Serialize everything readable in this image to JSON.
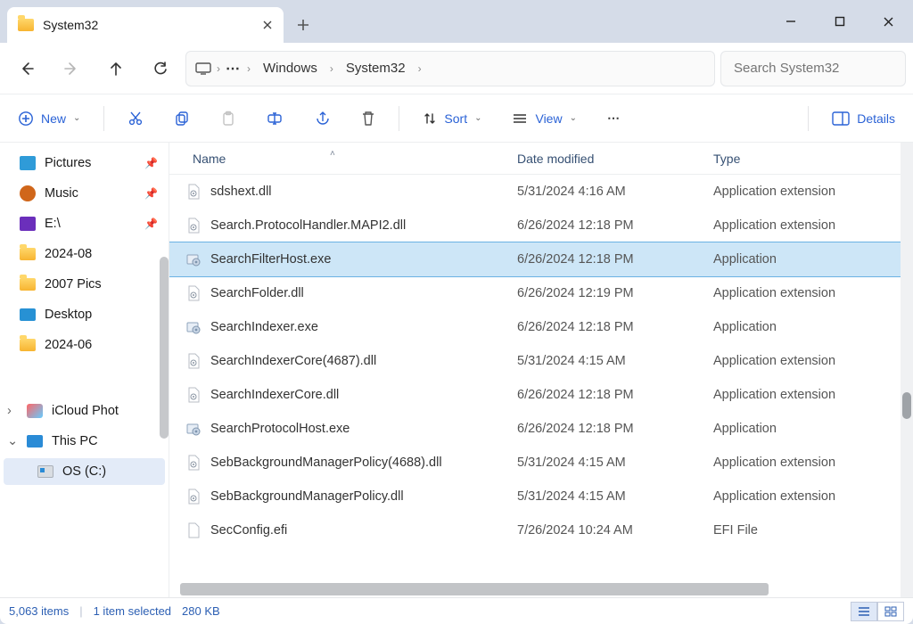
{
  "window": {
    "title": "System32"
  },
  "breadcrumb": {
    "segments": [
      "Windows",
      "System32"
    ]
  },
  "search": {
    "placeholder": "Search System32"
  },
  "toolbar": {
    "new": "New",
    "sort": "Sort",
    "view": "View",
    "details": "Details"
  },
  "sidebar": {
    "items": [
      {
        "label": "Pictures",
        "icon": "pictures",
        "pinned": true
      },
      {
        "label": "Music",
        "icon": "music",
        "pinned": true
      },
      {
        "label": "E:\\",
        "icon": "drive-e",
        "pinned": true
      },
      {
        "label": "2024-08",
        "icon": "folder",
        "pinned": false
      },
      {
        "label": "2007 Pics",
        "icon": "folder",
        "pinned": false
      },
      {
        "label": "Desktop",
        "icon": "desktop",
        "pinned": false
      },
      {
        "label": "2024-06",
        "icon": "folder",
        "pinned": false
      },
      {
        "label": "iCloud Phot",
        "icon": "icloud",
        "pinned": false,
        "expandable": true,
        "indent": true
      },
      {
        "label": "This PC",
        "icon": "pc",
        "pinned": false,
        "expandable": true,
        "expanded": true
      },
      {
        "label": "OS (C:)",
        "icon": "drive-c",
        "pinned": false,
        "selected": true,
        "child": true
      }
    ]
  },
  "columns": {
    "name": "Name",
    "date": "Date modified",
    "type": "Type",
    "sort": "name",
    "dir": "asc"
  },
  "rows": [
    {
      "name": "sdshext.dll",
      "date": "5/31/2024 4:16 AM",
      "type": "Application extension",
      "kind": "dll"
    },
    {
      "name": "Search.ProtocolHandler.MAPI2.dll",
      "date": "6/26/2024 12:18 PM",
      "type": "Application extension",
      "kind": "dll"
    },
    {
      "name": "SearchFilterHost.exe",
      "date": "6/26/2024 12:18 PM",
      "type": "Application",
      "kind": "exe",
      "selected": true
    },
    {
      "name": "SearchFolder.dll",
      "date": "6/26/2024 12:19 PM",
      "type": "Application extension",
      "kind": "dll"
    },
    {
      "name": "SearchIndexer.exe",
      "date": "6/26/2024 12:18 PM",
      "type": "Application",
      "kind": "exe"
    },
    {
      "name": "SearchIndexerCore(4687).dll",
      "date": "5/31/2024 4:15 AM",
      "type": "Application extension",
      "kind": "dll"
    },
    {
      "name": "SearchIndexerCore.dll",
      "date": "6/26/2024 12:18 PM",
      "type": "Application extension",
      "kind": "dll"
    },
    {
      "name": "SearchProtocolHost.exe",
      "date": "6/26/2024 12:18 PM",
      "type": "Application",
      "kind": "exe"
    },
    {
      "name": "SebBackgroundManagerPolicy(4688).dll",
      "date": "5/31/2024 4:15 AM",
      "type": "Application extension",
      "kind": "dll"
    },
    {
      "name": "SebBackgroundManagerPolicy.dll",
      "date": "5/31/2024 4:15 AM",
      "type": "Application extension",
      "kind": "dll"
    },
    {
      "name": "SecConfig.efi",
      "date": "7/26/2024 10:24 AM",
      "type": "EFI File",
      "kind": "file"
    }
  ],
  "status": {
    "items": "5,063 items",
    "selection": "1 item selected",
    "size": "280 KB"
  }
}
